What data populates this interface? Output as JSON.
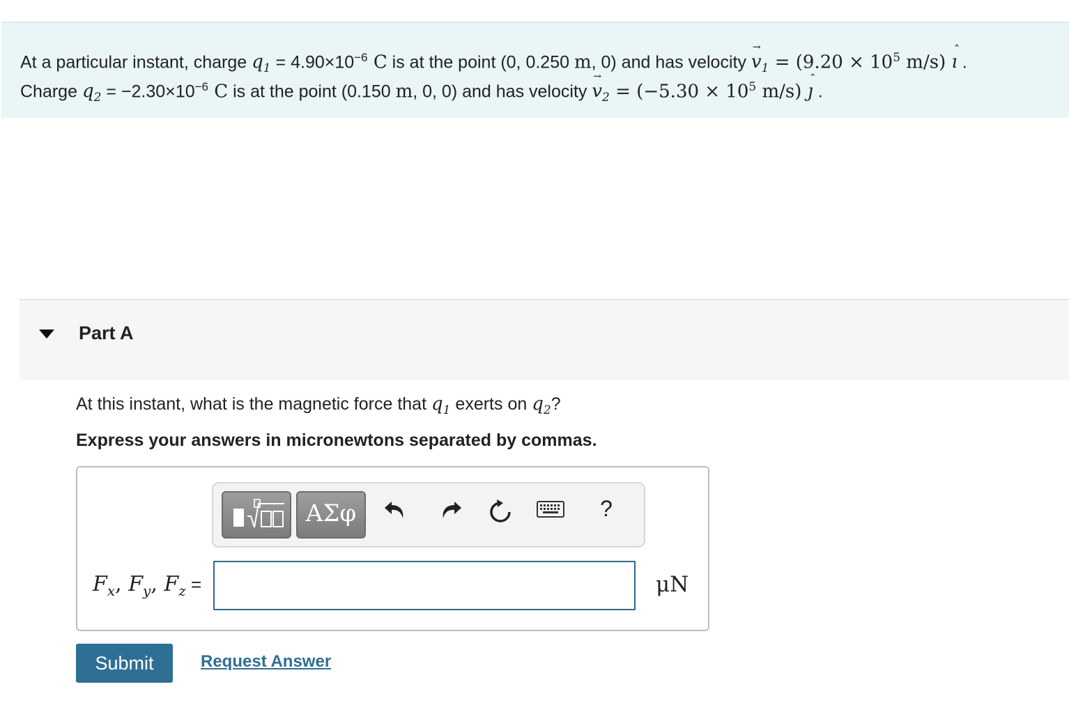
{
  "problem": {
    "line1": {
      "t1": "At a particular instant, charge ",
      "q": "q",
      "q_sub": "1",
      "t2": " = 4.90×10",
      "exp": "−6",
      "unit_c": " C",
      "t3": " is at the point (0, 0.250 ",
      "unit_m": "m",
      "t4": ", 0) and has velocity ",
      "v": "v",
      "v_sub": "1",
      "eq": " = ",
      "vel_open": "(9.20 × 10",
      "vel_exp": "5",
      "vel_unit": " m/s) ",
      "dir": "ı",
      "end": " ."
    },
    "line2": {
      "t1": "Charge ",
      "q": "q",
      "q_sub": "2",
      "t2": " = −2.30×10",
      "exp": "−6",
      "unit_c": " C",
      "t3": " is at the point (0.150 ",
      "unit_m": "m",
      "t4": ", 0, 0) and has velocity ",
      "v": "v",
      "v_sub": "2",
      "eq": " = ",
      "vel_open": "(−5.30 × 10",
      "vel_exp": "5",
      "vel_unit": " m/s) ",
      "dir": "ȷ",
      "end": " ."
    }
  },
  "part": {
    "title": "Part A",
    "question": {
      "t1": "At this instant, what is the magnetic force that ",
      "q1": "q",
      "q1_sub": "1",
      "t2": " exerts on ",
      "q2": "q",
      "q2_sub": "2",
      "t3": "?"
    },
    "instruction": "Express your answers in micronewtons separated by commas."
  },
  "toolbar": {
    "greek_label": "ΑΣφ",
    "help_label": "?",
    "icons": [
      "templates-icon",
      "greek-letters-icon",
      "undo-icon",
      "redo-icon",
      "reset-icon",
      "keyboard-icon",
      "help-icon"
    ]
  },
  "answer": {
    "label_parts": [
      "F",
      "x",
      ", ",
      "F",
      "y",
      ", ",
      "F",
      "z",
      " ="
    ],
    "input_value": "",
    "unit": "μN"
  },
  "actions": {
    "submit_label": "Submit",
    "request_answer_label": "Request Answer"
  },
  "colors": {
    "intro_background": "#e9f5f6",
    "part_header_background": "#f6f6f6",
    "accent": "#2f6f93",
    "input_border": "#2e6b8a"
  }
}
